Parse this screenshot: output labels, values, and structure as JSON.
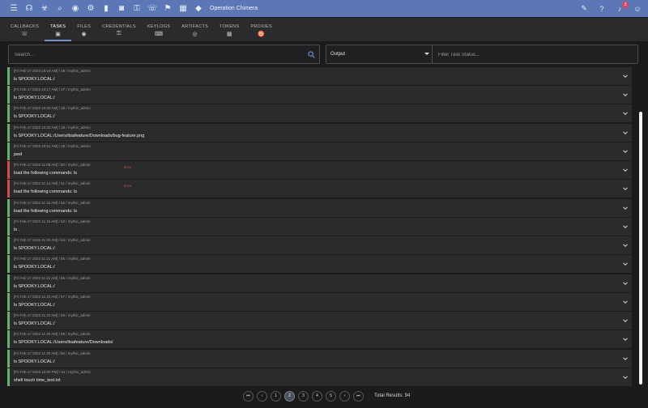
{
  "topbar": {
    "operation": "Operation Chimera",
    "notification_count": "3",
    "left_icons": [
      "menu-icon",
      "headset-icon",
      "biohazard-icon",
      "search-icon",
      "eye-icon",
      "gear-icon",
      "file-icon",
      "camera-icon",
      "key-icon",
      "phone-icon",
      "flag-icon",
      "grid-icon",
      "tag-icon"
    ],
    "right_icons": [
      "chat-icon",
      "help-icon",
      "bell-icon",
      "user-icon"
    ]
  },
  "tabs": [
    {
      "label": "CALLBACKS",
      "icon": "phone-icon",
      "glyph": "☏"
    },
    {
      "label": "TASKS",
      "icon": "task-icon",
      "glyph": "▣"
    },
    {
      "label": "FILES",
      "icon": "eye-icon",
      "glyph": "◉"
    },
    {
      "label": "CREDENTIALS",
      "icon": "key-icon",
      "glyph": "⚿"
    },
    {
      "label": "KEYLOGS",
      "icon": "keyboard-icon",
      "glyph": "⌨"
    },
    {
      "label": "ARTIFACTS",
      "icon": "fingerprint-icon",
      "glyph": "◎"
    },
    {
      "label": "TOKENS",
      "icon": "table-icon",
      "glyph": "▦"
    },
    {
      "label": "PROXIES",
      "icon": "sock-icon",
      "glyph": "♉"
    }
  ],
  "filters": {
    "search_placeholder": "Search...",
    "output_select": "Output",
    "task_status_placeholder": "Filter Task Status..."
  },
  "tasks": [
    {
      "meta": "[Fri Feb 17 2023 10:16 AM] / 26 / mythic_admin",
      "command": "ls SPOOKY.LOCAL:/",
      "status": "success",
      "error_label": ""
    },
    {
      "meta": "[Fri Feb 17 2023 10:17 AM] / 27 / mythic_admin",
      "command": "ls SPOOKY.LOCAL:/",
      "status": "success",
      "error_label": ""
    },
    {
      "meta": "[Fri Feb 17 2023 10:20 AM] / 28 / mythic_admin",
      "command": "ls SPOOKY.LOCAL:/",
      "status": "success",
      "error_label": ""
    },
    {
      "meta": "[Fri Feb 17 2023 10:20 AM] / 29 / mythic_admin",
      "command": "ls SPOOKY.LOCAL:/Users/itsafeature/Downloads/bug-feature.png",
      "status": "success",
      "error_label": ""
    },
    {
      "meta": "[Fri Feb 17 2023 10:51 AM] / 35 / mythic_admin",
      "command": "pwd",
      "status": "success",
      "error_label": ""
    },
    {
      "meta": "[Fri Feb 17 2023 11:09 AM] / 50 / mythic_admin",
      "command": "load the following commands: ls",
      "status": "error",
      "error_label": "error"
    },
    {
      "meta": "[Fri Feb 17 2023 11:14 AM] / 51 / mythic_admin",
      "command": "load the following commands: ls",
      "status": "error",
      "error_label": "error"
    },
    {
      "meta": "[Fri Feb 17 2023 11:16 AM] / 52 / mythic_admin",
      "command": "load the following commands: ls",
      "status": "success",
      "error_label": ""
    },
    {
      "meta": "[Fri Feb 17 2023 11:16 AM] / 53 / mythic_admin",
      "command": "ls .",
      "status": "success",
      "error_label": ""
    },
    {
      "meta": "[Fri Feb 17 2023 11:20 AM] / 54 / mythic_admin",
      "command": "ls SPOOKY.LOCAL:/",
      "status": "success",
      "error_label": ""
    },
    {
      "meta": "[Fri Feb 17 2023 11:21 AM] / 55 / mythic_admin",
      "command": "ls SPOOKY.LOCAL:/",
      "status": "success",
      "error_label": ""
    },
    {
      "meta": "[Fri Feb 17 2023 11:21 AM] / 56 / mythic_admin",
      "command": "ls SPOOKY.LOCAL:/",
      "status": "success",
      "error_label": ""
    },
    {
      "meta": "[Fri Feb 17 2023 11:23 AM] / 57 / mythic_admin",
      "command": "ls SPOOKY.LOCAL:/",
      "status": "success",
      "error_label": ""
    },
    {
      "meta": "[Fri Feb 17 2023 11:23 AM] / 58 / mythic_admin",
      "command": "ls SPOOKY.LOCAL:/",
      "status": "success",
      "error_label": ""
    },
    {
      "meta": "[Fri Feb 17 2023 11:25 AM] / 59 / mythic_admin",
      "command": "ls SPOOKY.LOCAL:/Users/itsafeature/Downloads/",
      "status": "success",
      "error_label": ""
    },
    {
      "meta": "[Fri Feb 17 2023 11:26 AM] / 60 / mythic_admin",
      "command": "ls SPOOKY.LOCAL:/",
      "status": "success",
      "error_label": ""
    },
    {
      "meta": "[Fri Feb 17 2023 12:00 PM] / 61 / mythic_admin",
      "command": "shell touch time_test.txt",
      "status": "success",
      "error_label": ""
    }
  ],
  "colors": {
    "topbar": "#5b77b5",
    "success": "#63b16b",
    "error": "#d24d4d",
    "row_bg": "#2b2b2d",
    "page_bg": "#1b1b1c"
  },
  "pagination": {
    "first_label": "⏮",
    "prev_label": "‹",
    "pages": [
      "1",
      "2",
      "3",
      "4",
      "5"
    ],
    "current_page": "2",
    "next_label": "›",
    "last_label": "⏭",
    "total": "Total Results: 94"
  }
}
